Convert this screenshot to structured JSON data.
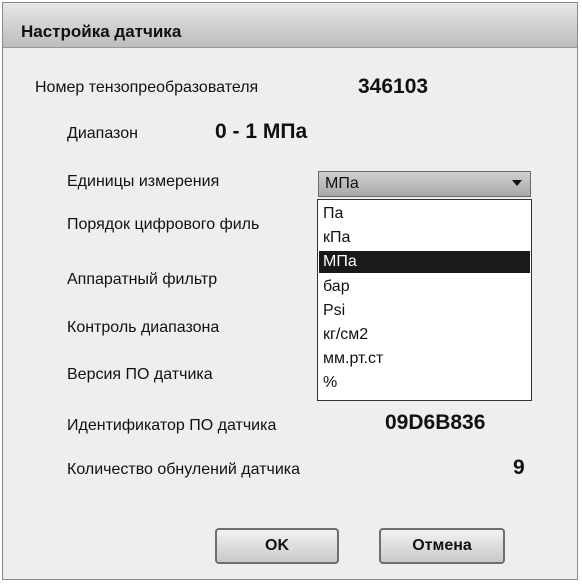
{
  "window": {
    "title": "Настройка датчика"
  },
  "fields": {
    "sensor_number": {
      "label": "Номер тензопреобразователя",
      "value": "346103"
    },
    "range": {
      "label": "Диапазон",
      "value": "0 - 1 МПа"
    },
    "units": {
      "label": "Единицы измерения",
      "selected": "МПа"
    },
    "digital_filter": {
      "label": "Порядок цифрового филь"
    },
    "hardware_filter": {
      "label": "Аппаратный фильтр"
    },
    "range_control": {
      "label": "Контроль диапазона"
    },
    "firmware_version": {
      "label": "Версия ПО датчика"
    },
    "firmware_id": {
      "label": "Идентификатор ПО датчика",
      "value": "09D6B836"
    },
    "zero_count": {
      "label": "Количество обнулений датчика",
      "value": "9"
    }
  },
  "dropdown": {
    "options": [
      "Па",
      "кПа",
      "МПа",
      "бар",
      "Psi",
      "кг/см2",
      "мм.рт.ст",
      "%"
    ],
    "selected_index": 2
  },
  "buttons": {
    "ok": "OK",
    "cancel": "Отмена"
  }
}
